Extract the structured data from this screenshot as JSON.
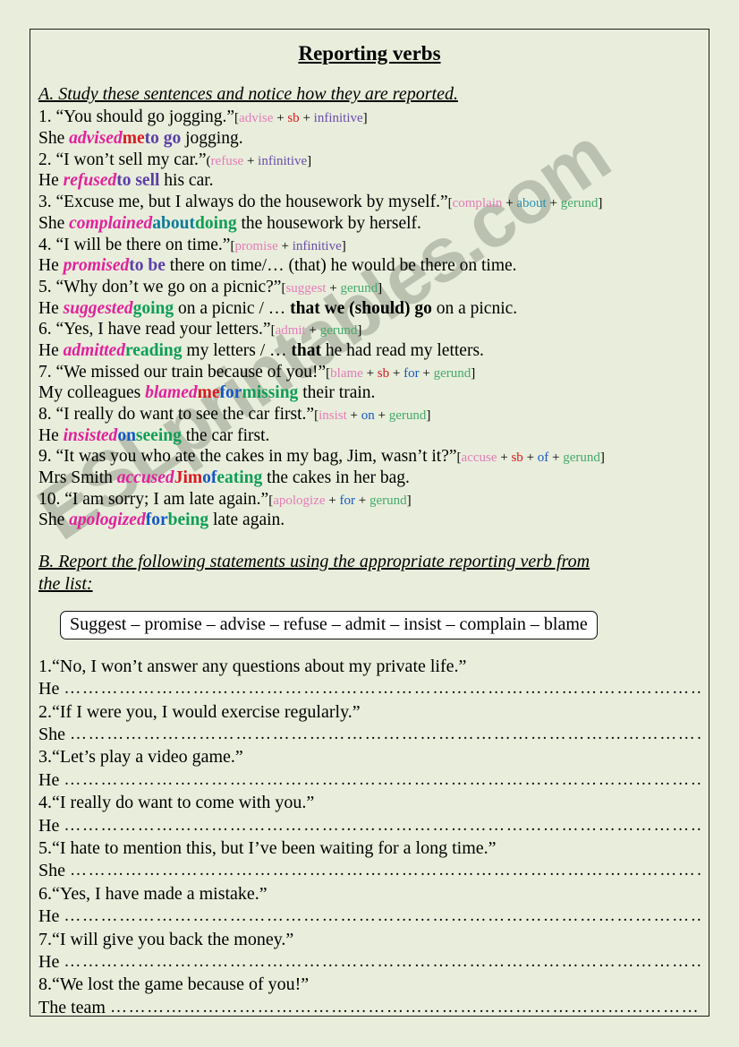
{
  "page": {
    "title": "Reporting verbs",
    "background_color": "#e9eedc",
    "border_color": "#1a1a1a",
    "watermark": "ESLprintables.com",
    "watermark_color": "#b9bfae"
  },
  "colors": {
    "verb": "#e1219b",
    "object": "#d81921",
    "infinitive": "#5b3ea8",
    "preposition_teal": "#0b7c99",
    "preposition_blue": "#1457c4",
    "gerund": "#0f9d58"
  },
  "section_a": {
    "heading": "A. Study these sentences and notice how they are reported.",
    "items": [
      {
        "number": "1.",
        "quote": "“You should go jogging.”",
        "pattern_open": "[",
        "pattern": [
          {
            "text": "advise",
            "role": "verb"
          },
          {
            "text": " + ",
            "role": "plain"
          },
          {
            "text": "sb",
            "role": "object"
          },
          {
            "text": " + ",
            "role": "plain"
          },
          {
            "text": "infinitive",
            "role": "infinitive"
          }
        ],
        "pattern_close": "]",
        "answer": [
          {
            "text": "She ",
            "role": "plain"
          },
          {
            "text": "advised",
            "role": "verb"
          },
          {
            "text": "me",
            "role": "object"
          },
          {
            "text": "to go",
            "role": "infinitive"
          },
          {
            "text": " jogging.",
            "role": "plain"
          }
        ]
      },
      {
        "number": "2.",
        "quote": "“I won’t sell my car.”",
        "pattern_open": "(",
        "pattern": [
          {
            "text": "refuse",
            "role": "verb"
          },
          {
            "text": " + ",
            "role": "plain"
          },
          {
            "text": "infinitive",
            "role": "infinitive"
          }
        ],
        "pattern_close": "]",
        "answer": [
          {
            "text": "He ",
            "role": "plain"
          },
          {
            "text": "refused",
            "role": "verb"
          },
          {
            "text": "to sell",
            "role": "infinitive"
          },
          {
            "text": " his car.",
            "role": "plain"
          }
        ]
      },
      {
        "number": "3.",
        "quote": "“Excuse me, but I always do the housework by myself.”",
        "pattern_open": "[",
        "pattern": [
          {
            "text": "complain",
            "role": "verb"
          },
          {
            "text": " + ",
            "role": "plain"
          },
          {
            "text": "about",
            "role": "preposition_teal"
          },
          {
            "text": " + ",
            "role": "plain"
          },
          {
            "text": "gerund",
            "role": "gerund"
          }
        ],
        "pattern_close": "]",
        "answer": [
          {
            "text": "She ",
            "role": "plain"
          },
          {
            "text": "complained",
            "role": "verb"
          },
          {
            "text": "about",
            "role": "preposition_teal"
          },
          {
            "text": "doing",
            "role": "gerund"
          },
          {
            "text": " the housework by herself.",
            "role": "plain"
          }
        ]
      },
      {
        "number": "4.",
        "quote": "“I will be there on time.”",
        "pattern_open": "[",
        "pattern": [
          {
            "text": "promise",
            "role": "verb"
          },
          {
            "text": " + ",
            "role": "plain"
          },
          {
            "text": "infinitive",
            "role": "infinitive"
          }
        ],
        "pattern_close": "]",
        "answer": [
          {
            "text": "He ",
            "role": "plain"
          },
          {
            "text": "promised",
            "role": "verb"
          },
          {
            "text": "to be",
            "role": "infinitive"
          },
          {
            "text": " there on time/… (that) he would be there on time.",
            "role": "plain"
          }
        ]
      },
      {
        "number": "5.",
        "quote": "“Why don’t we go on a picnic?”",
        "pattern_open": "[",
        "pattern": [
          {
            "text": "suggest",
            "role": "verb"
          },
          {
            "text": " + ",
            "role": "plain"
          },
          {
            "text": "gerund",
            "role": "gerund"
          }
        ],
        "pattern_close": "]",
        "answer": [
          {
            "text": "He ",
            "role": "plain"
          },
          {
            "text": "suggested",
            "role": "verb"
          },
          {
            "text": "going",
            "role": "gerund"
          },
          {
            "text": " on a picnic / … ",
            "role": "plain"
          },
          {
            "text": "that we (should) go",
            "role": "bold"
          },
          {
            "text": " on a picnic.",
            "role": "plain"
          }
        ]
      },
      {
        "number": "6.",
        "quote": "“Yes, I have read your letters.”",
        "pattern_open": "[",
        "pattern": [
          {
            "text": "admit",
            "role": "verb"
          },
          {
            "text": " + ",
            "role": "plain"
          },
          {
            "text": "gerund",
            "role": "gerund"
          }
        ],
        "pattern_close": "]",
        "answer": [
          {
            "text": "He ",
            "role": "plain"
          },
          {
            "text": "admitted",
            "role": "verb"
          },
          {
            "text": "reading",
            "role": "gerund"
          },
          {
            "text": " my letters / … ",
            "role": "plain"
          },
          {
            "text": "that",
            "role": "bold"
          },
          {
            "text": " he had read my letters.",
            "role": "plain"
          }
        ]
      },
      {
        "number": "7.",
        "quote": "“We missed our train because of you!”",
        "pattern_open": "[",
        "pattern": [
          {
            "text": "blame",
            "role": "verb"
          },
          {
            "text": " + ",
            "role": "plain"
          },
          {
            "text": "sb",
            "role": "object"
          },
          {
            "text": " + ",
            "role": "plain"
          },
          {
            "text": "for",
            "role": "preposition_blue"
          },
          {
            "text": " + ",
            "role": "plain"
          },
          {
            "text": "gerund",
            "role": "gerund"
          }
        ],
        "pattern_close": "]",
        "answer": [
          {
            "text": "My colleagues ",
            "role": "plain"
          },
          {
            "text": "blamed",
            "role": "verb"
          },
          {
            "text": "me",
            "role": "object"
          },
          {
            "text": "for",
            "role": "preposition_blue"
          },
          {
            "text": "missing",
            "role": "gerund"
          },
          {
            "text": " their train.",
            "role": "plain"
          }
        ]
      },
      {
        "number": "8.",
        "quote": "“I really do want to see the car first.”",
        "pattern_open": "[",
        "pattern": [
          {
            "text": "insist",
            "role": "verb"
          },
          {
            "text": " + ",
            "role": "plain"
          },
          {
            "text": "on",
            "role": "preposition_blue"
          },
          {
            "text": " + ",
            "role": "plain"
          },
          {
            "text": "gerund",
            "role": "gerund"
          }
        ],
        "pattern_close": "]",
        "answer": [
          {
            "text": "He ",
            "role": "plain"
          },
          {
            "text": "insisted",
            "role": "verb"
          },
          {
            "text": "on",
            "role": "preposition_blue"
          },
          {
            "text": "seeing",
            "role": "gerund"
          },
          {
            "text": " the car first.",
            "role": "plain"
          }
        ]
      },
      {
        "number": "9.",
        "quote": "“It was you who ate the cakes in my bag, Jim, wasn’t it?”",
        "pattern_open": "[",
        "pattern": [
          {
            "text": "accuse",
            "role": "verb"
          },
          {
            "text": " + ",
            "role": "plain"
          },
          {
            "text": "sb",
            "role": "object"
          },
          {
            "text": " + ",
            "role": "plain"
          },
          {
            "text": "of",
            "role": "preposition_blue"
          },
          {
            "text": " + ",
            "role": "plain"
          },
          {
            "text": "gerund",
            "role": "gerund"
          }
        ],
        "pattern_close": "]",
        "answer": [
          {
            "text": "Mrs Smith ",
            "role": "plain"
          },
          {
            "text": "accused",
            "role": "verb"
          },
          {
            "text": "Jim",
            "role": "object"
          },
          {
            "text": "of",
            "role": "preposition_blue"
          },
          {
            "text": "eating",
            "role": "gerund"
          },
          {
            "text": " the cakes in her bag.",
            "role": "plain"
          }
        ]
      },
      {
        "number": "10.",
        "quote": "“I am sorry; I am late again.”",
        "pattern_open": "[",
        "pattern": [
          {
            "text": "apologize",
            "role": "verb"
          },
          {
            "text": " + ",
            "role": "plain"
          },
          {
            "text": "for",
            "role": "preposition_blue"
          },
          {
            "text": " + ",
            "role": "plain"
          },
          {
            "text": "gerund",
            "role": "gerund"
          }
        ],
        "pattern_close": "]",
        "answer": [
          {
            "text": "She ",
            "role": "plain"
          },
          {
            "text": "apologized",
            "role": "verb"
          },
          {
            "text": "for",
            "role": "preposition_blue"
          },
          {
            "text": "being",
            "role": "gerund"
          },
          {
            "text": " late again.",
            "role": "plain"
          }
        ]
      }
    ]
  },
  "section_b": {
    "heading_line1": "B. Report the following statements using the appropriate reporting verb from",
    "heading_line2": "the list:",
    "wordbox": "Suggest – promise – advise – refuse – admit – insist – complain – blame",
    "questions": [
      {
        "number": "1.",
        "quote": "“No, I won’t answer any questions about my private life.”",
        "lead": "He",
        "dots": "……………………………………………………………………………………………………………………………………"
      },
      {
        "number": "2.",
        "quote": "“If I were you, I would exercise regularly.”",
        "lead": "She",
        "dots": "……………………………………………………………………………………………………………………………………"
      },
      {
        "number": "3.",
        "quote": "“Let’s play a video game.”",
        "lead": "He",
        "dots": "……………………………………………………………………………………………………………………………………"
      },
      {
        "number": "4.",
        "quote": "“I really do want to come with you.”",
        "lead": "He",
        "dots": "……………………………………………………………………………………………………………………………………"
      },
      {
        "number": "5.",
        "quote": "“I hate to mention this, but I’ve been waiting for a long time.”",
        "lead": "She",
        "dots": "……………………………………………………………………………………………………………………………………"
      },
      {
        "number": "6.",
        "quote": "“Yes, I have made a mistake.”",
        "lead": "He",
        "dots": "……………………………………………………………………………………………………………………………………"
      },
      {
        "number": "7.",
        "quote": "“I will give you back the money.”",
        "lead": "He",
        "dots": "……………………………………………………………………………………………………………………………………"
      },
      {
        "number": "8.",
        "quote": "“We lost the game because of you!”",
        "lead": "The team",
        "dots": "……………………………………………………………………………………………………………………………………"
      }
    ]
  }
}
